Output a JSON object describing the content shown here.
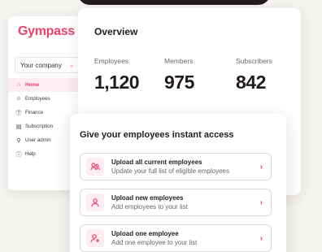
{
  "brand": {
    "logo": "Gympass",
    "accent": "#ef3f6a"
  },
  "company_select": {
    "value": "Your company"
  },
  "sidebar": {
    "items": [
      {
        "label": "Home",
        "icon": "home-icon",
        "active": true
      },
      {
        "label": "Employees",
        "icon": "user-icon",
        "active": false
      },
      {
        "label": "Finance",
        "icon": "dollar-icon",
        "active": false
      },
      {
        "label": "Subscription",
        "icon": "document-icon",
        "active": false
      },
      {
        "label": "User admin",
        "icon": "users-admin-icon",
        "active": false
      },
      {
        "label": "Help",
        "icon": "help-icon",
        "active": false
      }
    ]
  },
  "overview": {
    "title": "Overview",
    "stats": [
      {
        "label": "Employees",
        "value": "1,120"
      },
      {
        "label": "Members",
        "value": "975"
      },
      {
        "label": "Subscribers",
        "value": "842"
      }
    ]
  },
  "access": {
    "title": "Give your employees instant access",
    "options": [
      {
        "title": "Upload all current employees",
        "subtitle": "Update your full list of eligible employees",
        "icon": "users-upload-icon"
      },
      {
        "title": "Upload new employees",
        "subtitle": "Add employees to your list",
        "icon": "user-icon"
      },
      {
        "title": "Upload one employee",
        "subtitle": "Add one employee to your list",
        "icon": "user-add-icon"
      }
    ]
  }
}
